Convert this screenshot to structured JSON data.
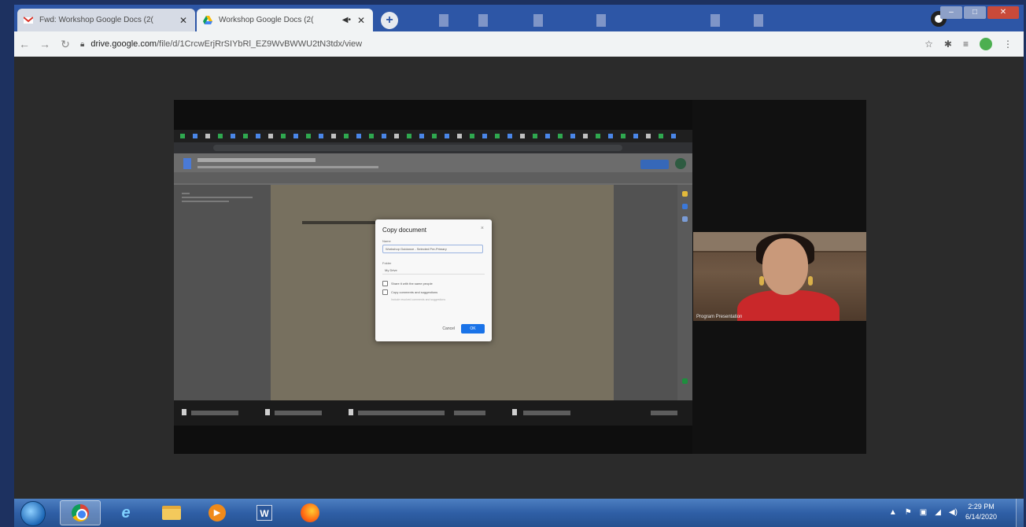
{
  "browser": {
    "tabs": [
      {
        "title": "Fwd: Workshop Google Docs (2(",
        "icon": "gmail-icon",
        "active": false
      },
      {
        "title": "Workshop Google Docs (2(",
        "icon": "drive-icon",
        "active": true
      }
    ],
    "new_tab_label": "+",
    "url_host": "drive.google.com",
    "url_path": "/file/d/1CrcwErjRrSIYbRl_EZ9WvBWWU2tN3tdx/view",
    "window_buttons": {
      "minimize": "–",
      "maximize": "□",
      "close": "✕"
    }
  },
  "dialog": {
    "title": "Copy document",
    "close": "×",
    "name_label": "Name",
    "name_value": "Workshop Guidance - Selected Pre-Primary",
    "folder_label": "Folder",
    "folder_value": "My Drive",
    "checkbox_share": "Share it with the same people",
    "checkbox_comments": "Copy comments and suggestions",
    "sub_note": "Include resolved comments and suggestions",
    "cancel_label": "Cancel",
    "ok_label": "OK"
  },
  "webcam": {
    "caption": "Program Presentation"
  },
  "taskbar": {
    "time": "2:29 PM",
    "date": "6/14/2020",
    "tray": [
      "▲",
      "⚑",
      "▣",
      "◢",
      "◀)"
    ]
  },
  "colors": {
    "tabstrip": "#2d56a6",
    "taskbar": "#2f5fa6",
    "dialog_ok": "#1a73e8"
  }
}
